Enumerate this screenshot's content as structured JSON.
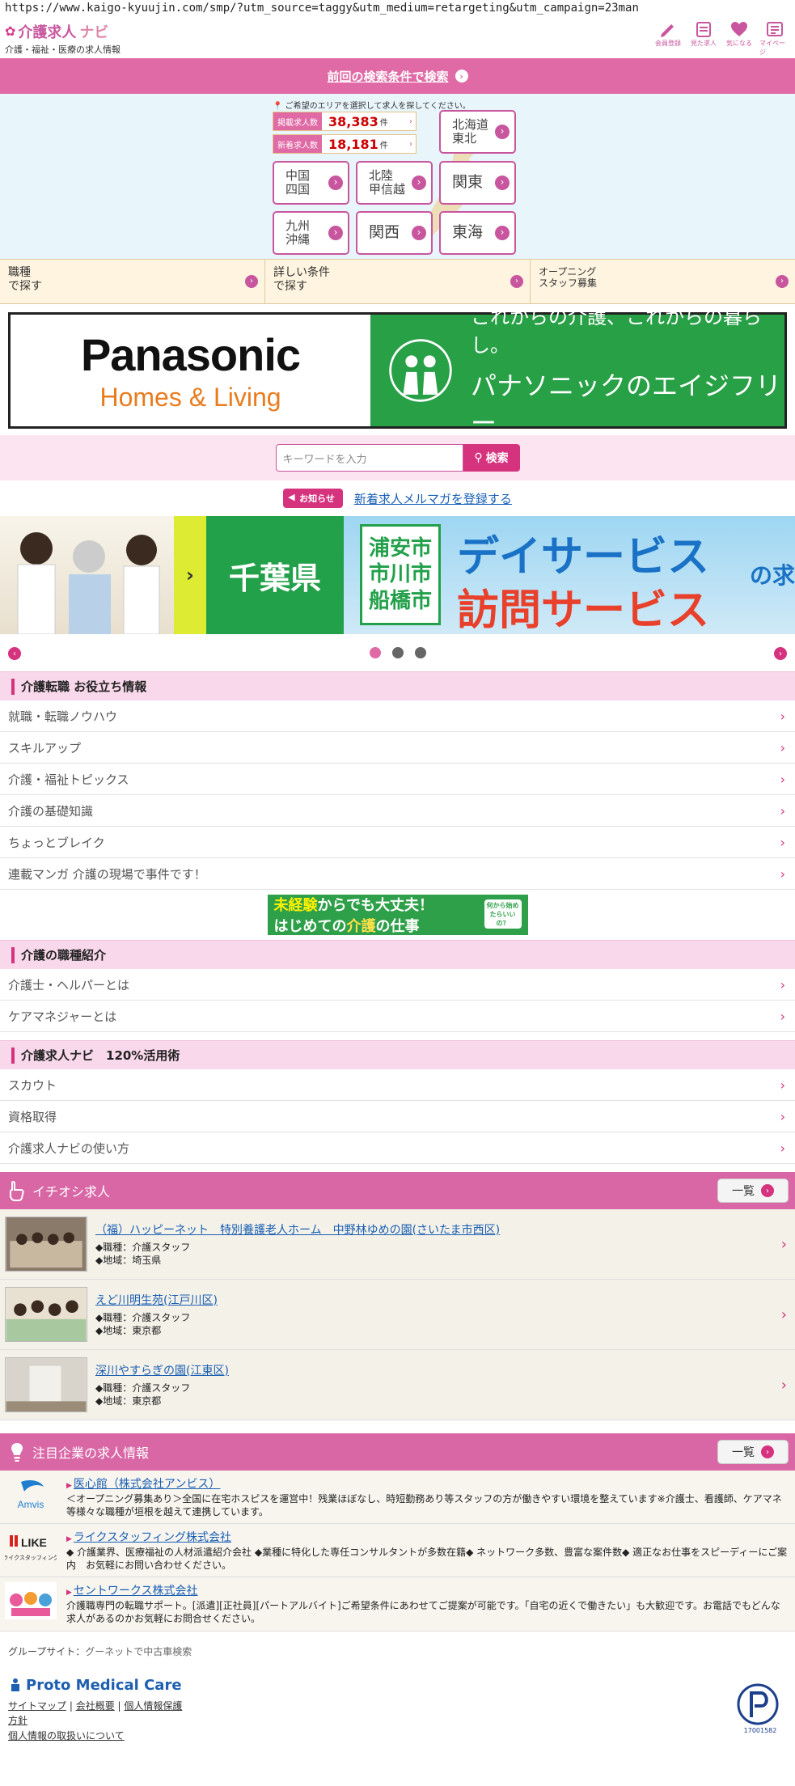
{
  "browser": {
    "url": "https://www.kaigo-kyuujin.com/smp/?utm_source=taggy&utm_medium=retargeting&utm_campaign=23man"
  },
  "header": {
    "logo_main": "介護求人",
    "logo_navi": "ナビ",
    "logo_sub": "介護・福祉・医療の求人情報",
    "icons": [
      {
        "icon": "pencil-icon",
        "label": "会員登録"
      },
      {
        "icon": "calendar-icon",
        "label": "見た求人"
      },
      {
        "icon": "heart-icon",
        "label": "気になる"
      },
      {
        "icon": "mypage-icon",
        "label": "マイページ"
      }
    ]
  },
  "prev_search": {
    "label": "前回の検索条件で検索"
  },
  "area": {
    "hint": "ご希望のエリアを選択して求人を探してください。",
    "counts": [
      {
        "label": "掲載求人数",
        "value": "38,383",
        "unit": "件"
      },
      {
        "label": "新着求人数",
        "value": "18,181",
        "unit": "件"
      }
    ],
    "regions": {
      "hokkaido_tohoku": {
        "line1": "北海道",
        "line2": "東北"
      },
      "chugoku_shikoku": {
        "line1": "中国",
        "line2": "四国"
      },
      "hokuriku_koshinetsu": {
        "line1": "北陸",
        "line2": "甲信越"
      },
      "kanto": "関東",
      "kyushu_okinawa": {
        "line1": "九州",
        "line2": "沖縄"
      },
      "kansai": "関西",
      "tokai": "東海"
    }
  },
  "search_options": [
    {
      "line1": "職種",
      "line2": "で探す"
    },
    {
      "line1": "詳しい条件",
      "line2": "で探す"
    },
    {
      "line1": "オープニング",
      "line2": "スタッフ募集"
    }
  ],
  "pana_banner": {
    "brand": "Panasonic",
    "sub": "Homes & Living",
    "text1": "これからの介護、これからの暮らし。",
    "text2": "パナソニックのエイジフリー"
  },
  "keyword": {
    "placeholder": "キーワードを入力",
    "button": "検索"
  },
  "notice": {
    "tag": "お知らせ",
    "link": "新着求人メルマガを登録する"
  },
  "hero": {
    "prefecture": "千葉県",
    "cities": [
      "浦安市",
      "市川市",
      "船橋市"
    ],
    "t1": "デイサービス",
    "t2": "訪問サービス",
    "t3": "の求"
  },
  "section_useful": {
    "title": "介護転職 お役立ち情報",
    "items": [
      "就職・転職ノウハウ",
      "スキルアップ",
      "介護・福祉トピックス",
      "介護の基礎知識",
      "ちょっとブレイク",
      "連載マンガ 介護の現場で事件です！"
    ]
  },
  "mini_banner": {
    "l1a": "未経験",
    "l1b": "からでも大丈夫！",
    "l2a": "はじめての",
    "l2b": "介護",
    "l2c": "の仕事",
    "badge": "何から始めたらいいの？"
  },
  "section_jobs": {
    "title": "介護の職種紹介",
    "items": [
      "介護士・ヘルパーとは",
      "ケアマネジャーとは"
    ]
  },
  "section_navi": {
    "title": "介護求人ナビ　120%活用術",
    "items": [
      "スカウト",
      "資格取得",
      "介護求人ナビの使い方"
    ]
  },
  "featured": {
    "title": "イチオシ求人",
    "list_button": "一覧",
    "jobs": [
      {
        "title": "（福）ハッピーネット　特別養護老人ホーム　中野林ゆめの園(さいたま市西区)",
        "role": "◆職種：介護スタッフ",
        "area": "◆地域：埼玉県"
      },
      {
        "title": "えど川明生苑(江戸川区)",
        "role": "◆職種：介護スタッフ",
        "area": "◆地域：東京都"
      },
      {
        "title": "深川やすらぎの園(江東区)",
        "role": "◆職種：介護スタッフ",
        "area": "◆地域：東京都"
      }
    ]
  },
  "companies": {
    "title": "注目企業の求人情報",
    "list_button": "一覧",
    "items": [
      {
        "logo": "Amvis",
        "name": "医心館（株式会社アンビス）",
        "desc": "＜オープニング募集あり＞全国に在宅ホスピスを運営中！残業ほぼなし、時短勤務あり等スタッフの方が働きやすい環境を整えています※介護士、看護師、ケアマネ等様々な職種が垣根を越えて連携しています。"
      },
      {
        "logo": "LIKE",
        "logo_sub": "ライクスタッフィング",
        "name": "ライクスタッフィング株式会社",
        "desc": "◆ 介護業界、医療福祉の人材派遣紹介会社 ◆業種に特化した専任コンサルタントが多数在籍◆ ネットワーク多数、豊富な案件数◆ 適正なお仕事をスピーディーにご案内　お気軽にお問い合わせください。"
      },
      {
        "logo": "",
        "name": "セントワークス株式会社",
        "desc": "介護職専門の転職サポート。[派遣][正社員][パートアルバイト]ご希望条件にあわせてご提案が可能です。「自宅の近くで働きたい」も大歓迎です。お電話でもどんな求人があるのかお気軽にお問合せください。"
      }
    ]
  },
  "group_site": {
    "label": "グループサイト：",
    "link": "グーネットで中古車検索"
  },
  "footer": {
    "brand": "Proto Medical Care",
    "links": [
      "サイトマップ",
      "会社概要",
      "個人情報保護",
      "方針",
      "個人情報の取扱いについて"
    ],
    "privacy_number": "17001582"
  },
  "colors": {
    "accent": "#e06aa5",
    "deep_pink": "#d6337f",
    "map_bg": "#e8f6fc",
    "green": "#27a046"
  }
}
